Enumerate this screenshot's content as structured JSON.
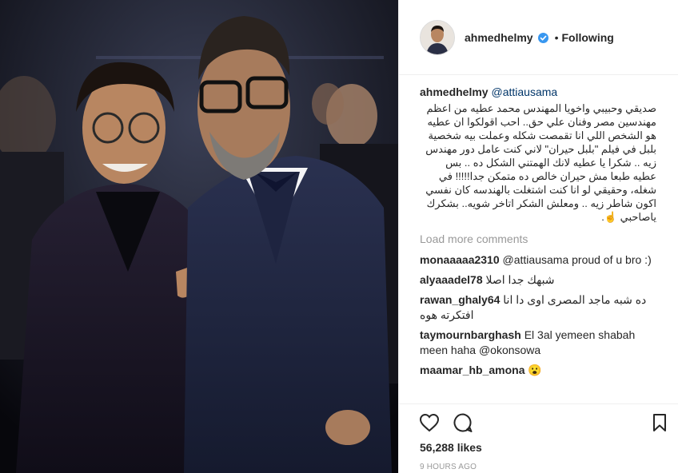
{
  "post": {
    "photo_alt_icon": "photo",
    "header": {
      "username": "ahmedhelmy",
      "dot": "•",
      "follow_label": "Following"
    },
    "caption": {
      "username": "ahmedhelmy",
      "mention": "@attiausama",
      "text": "صديقي وحبيبي واخويا المهندس محمد عطيه من اعظم مهندسين مصر وفنان علي حق.. احب اقولكوا ان عطيه هو الشخص اللي انا تقمصت شكله وعملت بيه شخصية بلبل في فيلم \"بلبل حيران\" لاني كنت عامل دور مهندس زيه .. شكرا يا عطيه لانك الهمتني الشكل ده .. بس عطيه طبعا مش حيران خالص ده متمكن جدا!!!!! في شغله، وحقيقي لو انا كنت اشتغلت بالهندسه كان نفسي اكون شاطر زيه .. ومعلش الشكر اتاخر شويه.. بشكرك ياصاحبي ☝️."
    },
    "load_more": "Load more comments",
    "comments": [
      {
        "user": "monaaaaa2310",
        "text": "@attiausama proud of u bro :)",
        "rtl": false
      },
      {
        "user": "alyaaadel78",
        "text": "شبهك جدا اصلا",
        "rtl": false
      },
      {
        "user": "rawan_ghaly64",
        "text": "ده شبه ماجد المصرى اوى دا انا افتكرته هوه",
        "rtl": false
      },
      {
        "user": "taymournbarghash",
        "text": "El 3al yemeen shabah meen haha @okonsowa",
        "rtl": false
      },
      {
        "user": "maamar_hb_amona",
        "text": "😮",
        "rtl": false
      }
    ],
    "likes": "56,288 likes",
    "time": "9 HOURS AGO"
  },
  "colors": {
    "link": "#003569",
    "muted": "#999999",
    "verified": "#3897f0"
  }
}
